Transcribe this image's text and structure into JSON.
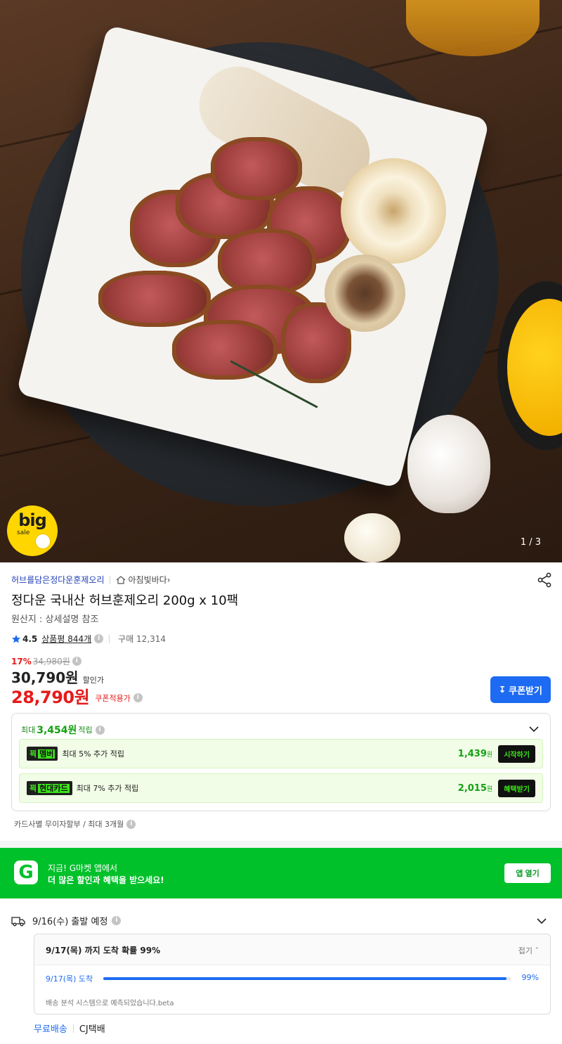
{
  "hero": {
    "badge_big": "big",
    "badge_sale": "sale",
    "pager": "1 / 3"
  },
  "product": {
    "shop_name": "허브를담은정다운훈제오리",
    "market": "아침빛바다",
    "title": "정다운 국내산 허브훈제오리 200g x 10팩",
    "origin": "원산지 : 상세설명 참조",
    "rating": "4.5",
    "review_count": "상품평 844개",
    "purchase_count": "구매 12,314"
  },
  "price": {
    "discount_pct": "17%",
    "original": "34,980원",
    "sale": "30,790원",
    "sale_tag": "할인가",
    "coupon_price": "28,790원",
    "coupon_tag": "쿠폰적용가",
    "coupon_button": "쿠폰받기"
  },
  "points": {
    "prefix": "최대",
    "amount": "3,454원",
    "suffix": "적립",
    "rows": [
      {
        "tag_a": "꾁",
        "tag_b": "멤버",
        "desc": "최대 5% 추가 적립",
        "amount": "1,439",
        "unit": "원",
        "button": "시작하기"
      },
      {
        "tag_a": "꾁",
        "tag_b": "현대카드",
        "desc": "최대 7% 추가 적립",
        "amount": "2,015",
        "unit": "원",
        "button": "혜택받기"
      }
    ],
    "installment": "카드사별 무이자할부 / 최대 3개월"
  },
  "banner": {
    "logo": "G",
    "line1": "지금! G마켓 앱에서",
    "line2": "더 많은 할인과 혜택을 받으세요!",
    "button": "앱 열기"
  },
  "shipping": {
    "depart": "9/16(수) 출발 예정",
    "probability": "9/17(목) 까지 도착 확률 99%",
    "fold": "접기",
    "arrival_label": "9/17(목) 도착",
    "arrival_pct": "99%",
    "arrival_value": 0.99,
    "beta_note": "배송 분석 시스템으로 예측되었습니다.beta",
    "free": "무료배송",
    "carrier": "CJ택배"
  },
  "colors": {
    "brand_green": "#00c12a",
    "price_red": "#e61b1b",
    "accent_blue": "#1d6bf2"
  }
}
